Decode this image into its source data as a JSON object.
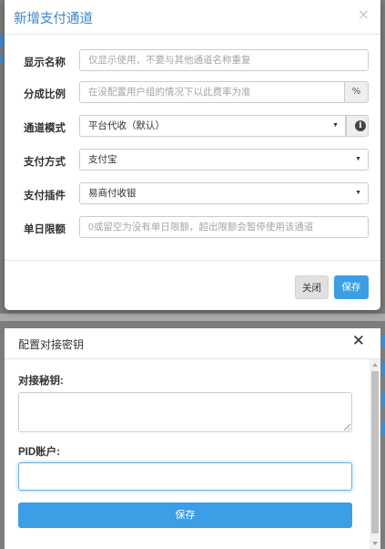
{
  "modal_channel": {
    "title": "新增支付通道",
    "close_glyph": "×",
    "fields": {
      "display_name": {
        "label": "显示名称",
        "placeholder": "仅显示使用，不要与其他通道名称重复"
      },
      "share_ratio": {
        "label": "分成比例",
        "placeholder": "在没配置用户组的情况下以此费率为准",
        "addon": "%"
      },
      "channel_mode": {
        "label": "通道模式",
        "value": "平台代收（默认）",
        "info_glyph": "i"
      },
      "pay_method": {
        "label": "支付方式",
        "value": "支付宝"
      },
      "pay_plugin": {
        "label": "支付插件",
        "value": "易商付收银"
      },
      "daily_limit": {
        "label": "单日限额",
        "placeholder": "0或留空为没有单日限额，超出限额会暂停使用该通道"
      }
    },
    "buttons": {
      "close": "关闭",
      "save": "保存"
    }
  },
  "modal_key": {
    "title": "配置对接密钥",
    "close_glyph": "✕",
    "fields": {
      "secret": {
        "label": "对接秘钥:"
      },
      "pid": {
        "label": "PID账户:"
      }
    },
    "buttons": {
      "save": "保存"
    }
  },
  "select_caret": "▼",
  "colors": {
    "accent": "#3c9ee5",
    "title_blue": "#3a87c8",
    "backdrop": "#7c7c7c"
  }
}
